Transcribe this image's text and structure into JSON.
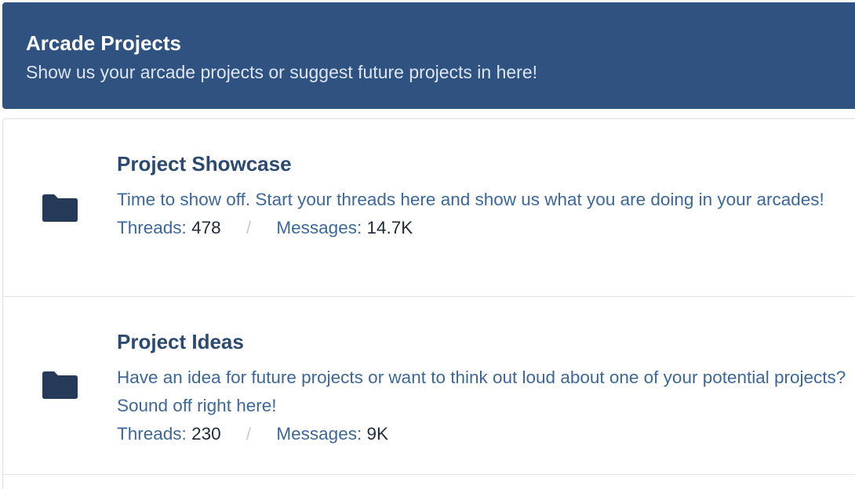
{
  "category": {
    "title": "Arcade Projects",
    "description": "Show us your arcade projects or suggest future projects in here!"
  },
  "forums": [
    {
      "title": "Project Showcase",
      "description": "Time to show off. Start your threads here and show us what you are doing in your arcades!",
      "threads_label": "Threads:",
      "threads_value": "478",
      "separator": "/",
      "messages_label": "Messages:",
      "messages_value": "14.7K",
      "icon": "folder-icon"
    },
    {
      "title": "Project Ideas",
      "description": "Have an idea for future projects or want to think out loud about one of your potential projects? Sound off right here!",
      "threads_label": "Threads:",
      "threads_value": "230",
      "separator": "/",
      "messages_label": "Messages:",
      "messages_value": "9K",
      "icon": "folder-icon"
    }
  ],
  "colors": {
    "header_bg": "#2f5281",
    "title": "#2c4a70",
    "link_text": "#3d6799",
    "folder": "#253a58"
  }
}
